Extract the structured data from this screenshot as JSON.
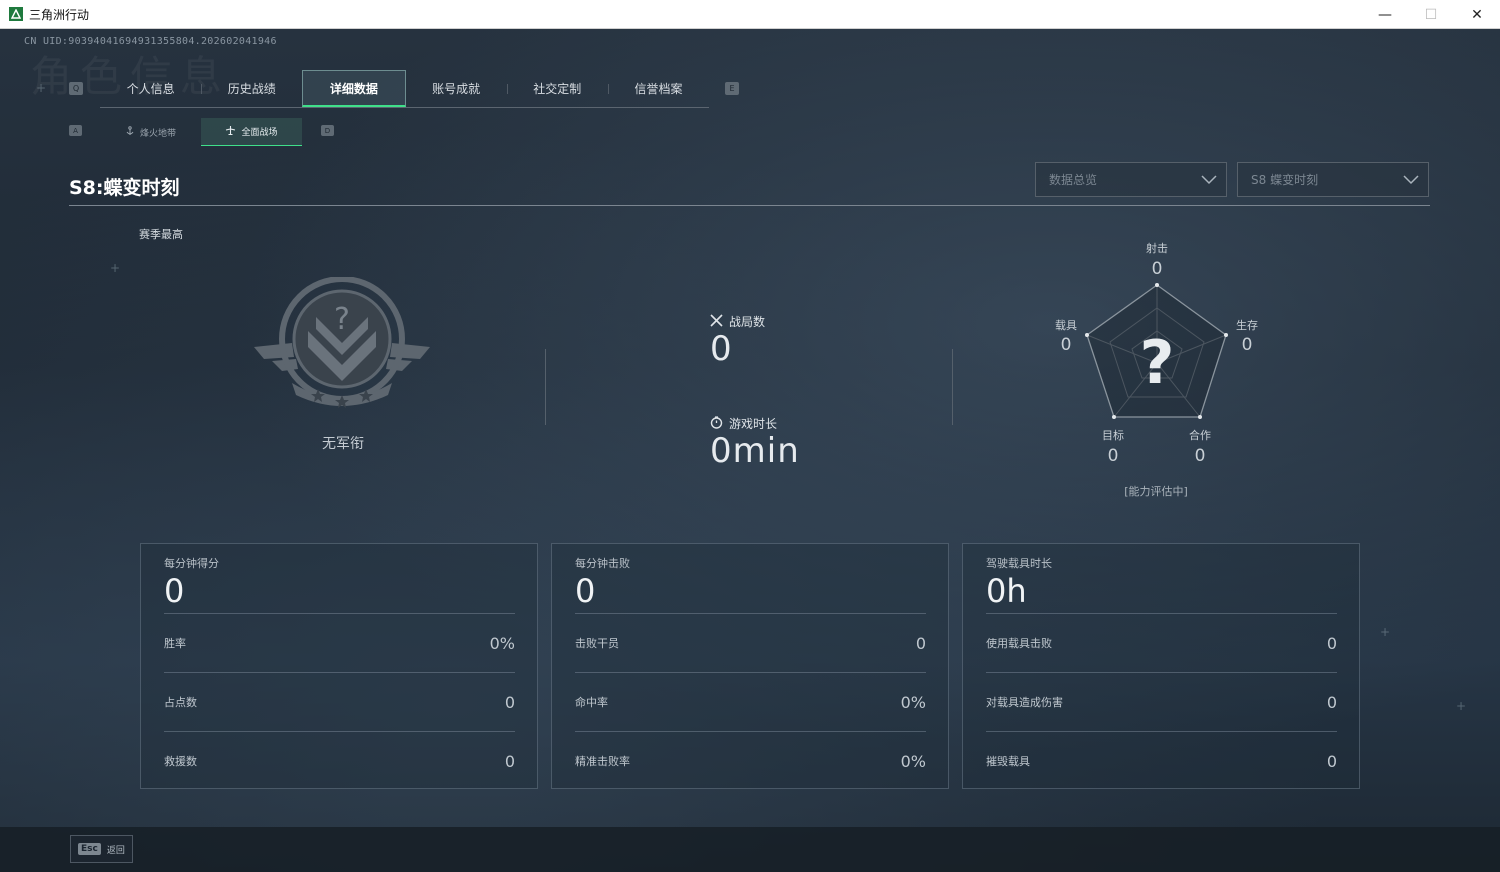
{
  "window": {
    "title": "三角洲行动",
    "controls": {
      "minimize": "—",
      "maximize": "☐",
      "close": "✕"
    }
  },
  "header": {
    "uid": "CN UID:90394041694931355804.202602041946",
    "watermark": "角色信息",
    "key_left": "Q",
    "key_right": "E"
  },
  "tabs": [
    {
      "label": "个人信息",
      "active": false
    },
    {
      "label": "历史战绩",
      "active": false
    },
    {
      "label": "详细数据",
      "active": true
    },
    {
      "label": "账号成就",
      "active": false
    },
    {
      "label": "社交定制",
      "active": false
    },
    {
      "label": "信誉档案",
      "active": false
    }
  ],
  "subtabs": {
    "key_left": "A",
    "key_right": "D",
    "items": [
      {
        "label": "烽火地带",
        "icon": "anchor-icon",
        "active": false
      },
      {
        "label": "全面战场",
        "icon": "aircraft-icon",
        "active": true
      }
    ]
  },
  "season": {
    "title": "S8:蝶变时刻",
    "filter_type": "数据总览",
    "filter_season": "S8 蝶变时刻",
    "best_label": "赛季最高"
  },
  "rank": {
    "name": "无军衔",
    "icon": "rank-badge-icon"
  },
  "middle": {
    "matches_label": "战局数",
    "matches_value": "0",
    "playtime_label": "游戏时长",
    "playtime_value": "0min"
  },
  "radar": {
    "center_symbol": "?",
    "note": "[能力评估中]",
    "axes": [
      {
        "label": "射击",
        "value": "0"
      },
      {
        "label": "生存",
        "value": "0"
      },
      {
        "label": "合作",
        "value": "0"
      },
      {
        "label": "目标",
        "value": "0"
      },
      {
        "label": "载具",
        "value": "0"
      }
    ]
  },
  "cards": [
    {
      "title": "每分钟得分",
      "value": "0",
      "rows": [
        {
          "label": "胜率",
          "value": "0%"
        },
        {
          "label": "占点数",
          "value": "0"
        },
        {
          "label": "救援数",
          "value": "0"
        }
      ]
    },
    {
      "title": "每分钟击败",
      "value": "0",
      "rows": [
        {
          "label": "击败干员",
          "value": "0"
        },
        {
          "label": "命中率",
          "value": "0%"
        },
        {
          "label": "精准击败率",
          "value": "0%"
        }
      ]
    },
    {
      "title": "驾驶载具时长",
      "value": "0h",
      "rows": [
        {
          "label": "使用载具击败",
          "value": "0"
        },
        {
          "label": "对载具造成伤害",
          "value": "0"
        },
        {
          "label": "摧毁载具",
          "value": "0"
        }
      ]
    }
  ],
  "footer": {
    "esc_key": "Esc",
    "esc_label": "返回"
  },
  "colors": {
    "accent": "#3fe08a",
    "background": "#1c2530"
  }
}
